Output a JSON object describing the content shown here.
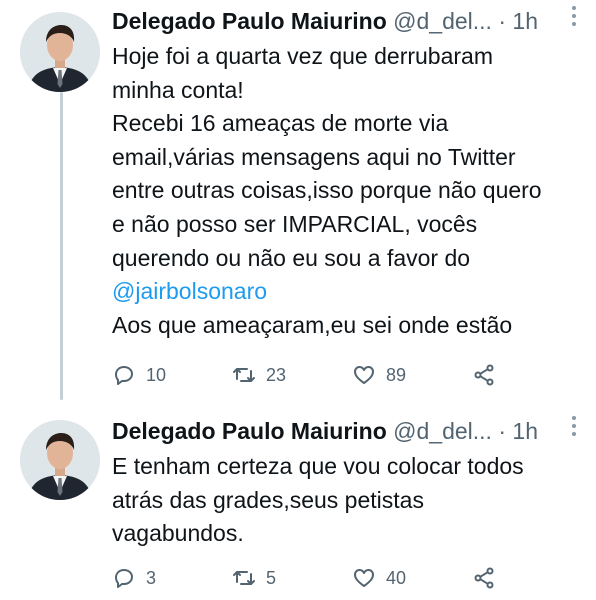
{
  "tweets": [
    {
      "name": "Delegado Paulo Maiurino",
      "handle": "@d_del...",
      "dot": "·",
      "time": "1h",
      "lines": [
        "Hoje foi a quarta vez que derrubaram",
        "minha conta!",
        "Recebi 16 ameaças de morte via",
        "email,várias mensagens aqui no Twitter",
        "entre outras coisas,isso porque não quero",
        "e não posso ser IMPARCIAL, vocês",
        "querendo ou não eu sou a favor do"
      ],
      "mention": "@jairbolsonaro",
      "last_line": "Aos que ameaçaram,eu sei onde estão",
      "replies": "10",
      "retweets": "23",
      "likes": "89"
    },
    {
      "name": "Delegado Paulo Maiurino",
      "handle": "@d_del...",
      "dot": "·",
      "time": "1h",
      "lines": [
        "E tenham certeza que vou colocar todos",
        "atrás das grades,seus petistas",
        "vagabundos."
      ],
      "replies": "3",
      "retweets": "5",
      "likes": "40"
    }
  ],
  "icons": {
    "reply": "reply-icon",
    "retweet": "retweet-icon",
    "like": "heart-icon",
    "share": "share-icon",
    "menu": "more-vertical-icon"
  },
  "colors": {
    "text": "#0f1419",
    "muted": "#536471",
    "mention": "#1d9bf0",
    "thread": "#c4cfd6"
  }
}
